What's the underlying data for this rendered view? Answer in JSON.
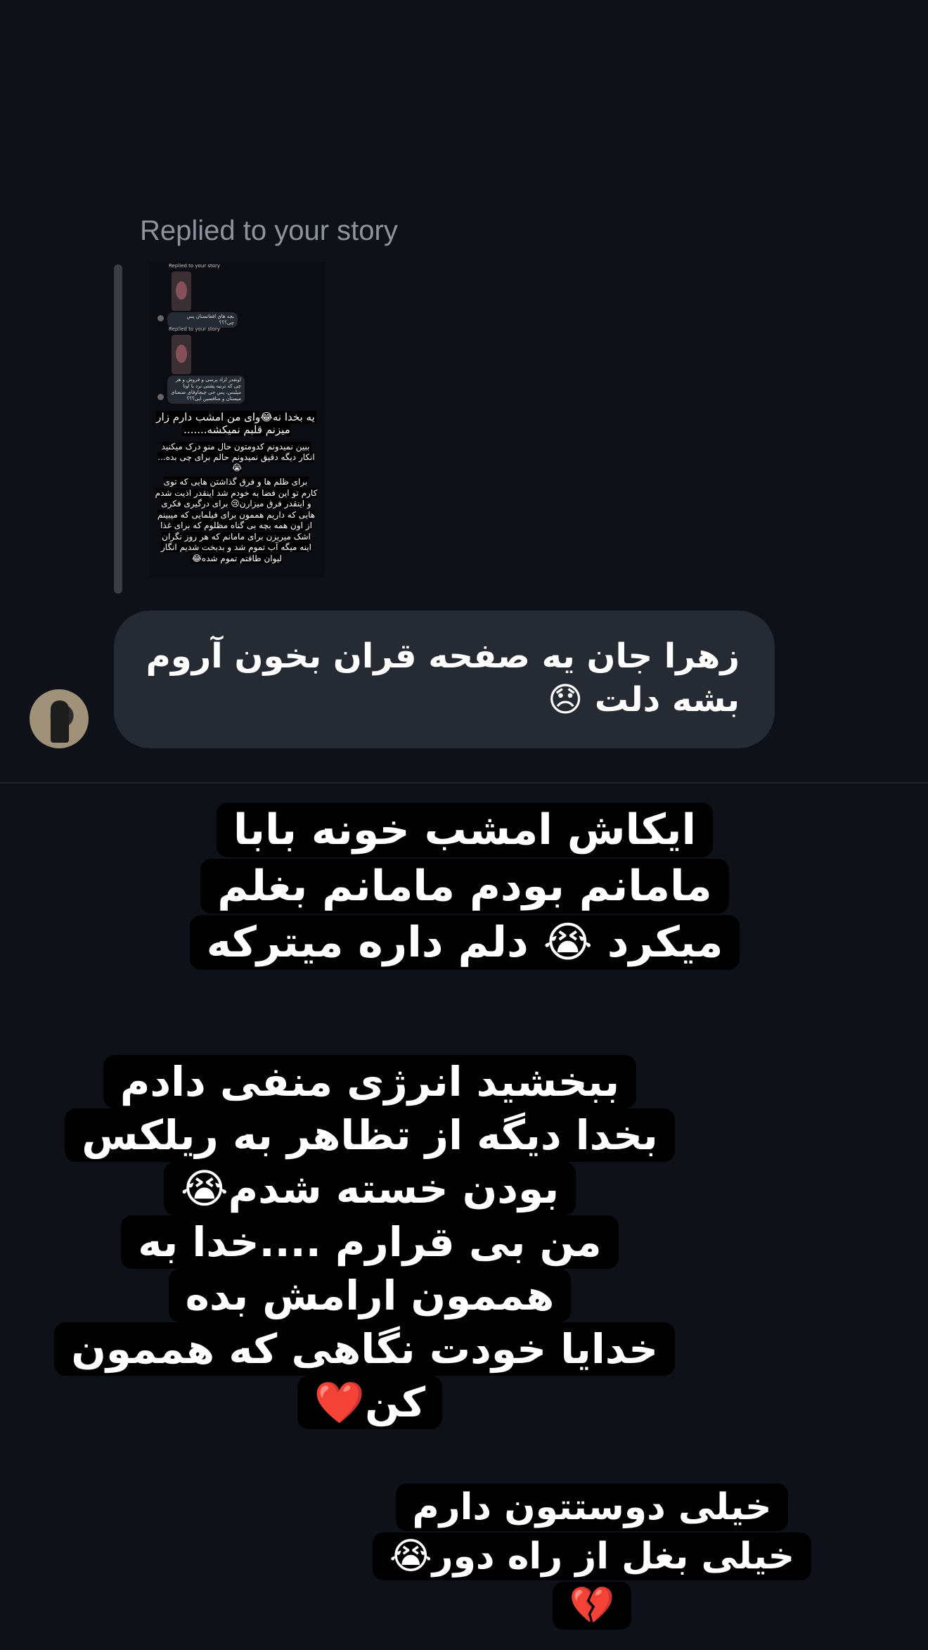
{
  "reply": {
    "label": "Replied to your story"
  },
  "quoted_story": {
    "header_1": "Replied to your story",
    "msg_1": "بچه های افغانستان پس چی؟؟؟",
    "header_2": "Replied to your story",
    "msg_2": "اونقدر لزاد پرسی و فروش و هر چی که ترنیه پشتی نرد با اونا مپلیس، پس جی چیچاوقای صنعتای میستان و منافسین ایی؟؟؟",
    "caption_1": "یه بخدا نه😂وای من امشب دارم زار میزنم قلبم نمیکشه.......",
    "caption_2": "ببین نمیدونم کدومتون حال منو درک میکنید انکار دیگه دقیق نمیدونم حالم برای چی بده...😭",
    "caption_3": "برای ظلم ها و فرق گذاشتن هایی که توی کارم تو این فضا به خودم شد اینقدر اذیت شدم و اینقدر فرق میزارن😢 برای درگیری فکری هایی که داریم هممون برای فیلمایی که میبینم از اون همه بچه بی گناه مظلوم که برای غذا اشک میریزن برای مامانم که هر روز نگران اینه میگه آب تموم شد و بدبخت شدیم انگار لیوان طاقتم تموم شده😂"
  },
  "message": {
    "text": "زهرا جان یه صفحه قران بخون آروم بشه دلت 😞",
    "sender_avatar": "avatar"
  },
  "story": {
    "block_1": "ایکاش امشب خونه بابا مامانم بودم مامانم بغلم میکرد 😭 دلم داره میترکه",
    "block_2_line_1": "ببخشید انرژی منفی دادم بخدا دیگه از تظاهر به ریلکس بودن خسته شدم😭",
    "block_2_line_2": "من بی قرارم ....خدا به هممون ارامش بده",
    "block_2_line_3": "خدایا خودت نگاهی که هممون کن❤️",
    "block_3": "خیلی دوستتون دارم خیلی بغل از راه دور😭💔"
  },
  "colors": {
    "background": "#0e1117",
    "bubble": "#262a33",
    "muted_text": "#8e929a",
    "caption_bg": "#000000"
  }
}
